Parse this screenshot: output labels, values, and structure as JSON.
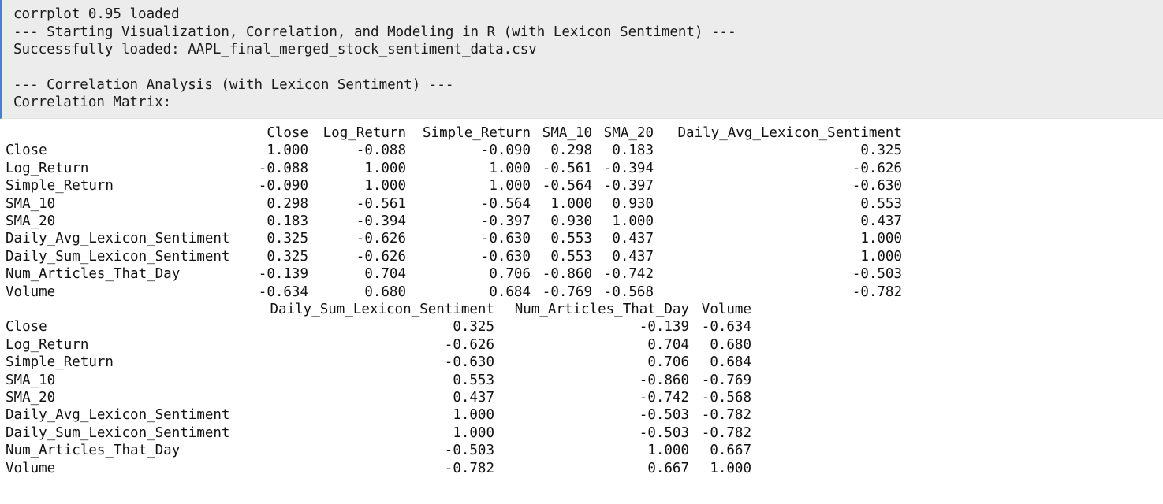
{
  "messages": [
    "corrplot 0.95 loaded",
    "--- Starting Visualization, Correlation, and Modeling in R (with Lexicon Sentiment) ---",
    "Successfully loaded: AAPL_final_merged_stock_sentiment_data.csv",
    "",
    "--- Correlation Analysis (with Lexicon Sentiment) ---",
    "Correlation Matrix:"
  ],
  "matrix": {
    "row_names": [
      "Close",
      "Log_Return",
      "Simple_Return",
      "SMA_10",
      "SMA_20",
      "Daily_Avg_Lexicon_Sentiment",
      "Daily_Sum_Lexicon_Sentiment",
      "Num_Articles_That_Day",
      "Volume"
    ],
    "block1": {
      "headers": [
        "Close",
        "Log_Return",
        "Simple_Return",
        "SMA_10",
        "SMA_20",
        "Daily_Avg_Lexicon_Sentiment"
      ],
      "rows": [
        [
          "1.000",
          "-0.088",
          "-0.090",
          "0.298",
          "0.183",
          "0.325"
        ],
        [
          "-0.088",
          "1.000",
          "1.000",
          "-0.561",
          "-0.394",
          "-0.626"
        ],
        [
          "-0.090",
          "1.000",
          "1.000",
          "-0.564",
          "-0.397",
          "-0.630"
        ],
        [
          "0.298",
          "-0.561",
          "-0.564",
          "1.000",
          "0.930",
          "0.553"
        ],
        [
          "0.183",
          "-0.394",
          "-0.397",
          "0.930",
          "1.000",
          "0.437"
        ],
        [
          "0.325",
          "-0.626",
          "-0.630",
          "0.553",
          "0.437",
          "1.000"
        ],
        [
          "0.325",
          "-0.626",
          "-0.630",
          "0.553",
          "0.437",
          "1.000"
        ],
        [
          "-0.139",
          "0.704",
          "0.706",
          "-0.860",
          "-0.742",
          "-0.503"
        ],
        [
          "-0.634",
          "0.680",
          "0.684",
          "-0.769",
          "-0.568",
          "-0.782"
        ]
      ]
    },
    "block2": {
      "headers": [
        "Daily_Sum_Lexicon_Sentiment",
        "Num_Articles_That_Day",
        "Volume"
      ],
      "rows": [
        [
          "0.325",
          "-0.139",
          "-0.634"
        ],
        [
          "-0.626",
          "0.704",
          "0.680"
        ],
        [
          "-0.630",
          "0.706",
          "0.684"
        ],
        [
          "0.553",
          "-0.860",
          "-0.769"
        ],
        [
          "0.437",
          "-0.742",
          "-0.568"
        ],
        [
          "1.000",
          "-0.503",
          "-0.782"
        ],
        [
          "1.000",
          "-0.503",
          "-0.782"
        ],
        [
          "-0.503",
          "1.000",
          "0.667"
        ],
        [
          "-0.782",
          "0.667",
          "1.000"
        ]
      ]
    }
  }
}
